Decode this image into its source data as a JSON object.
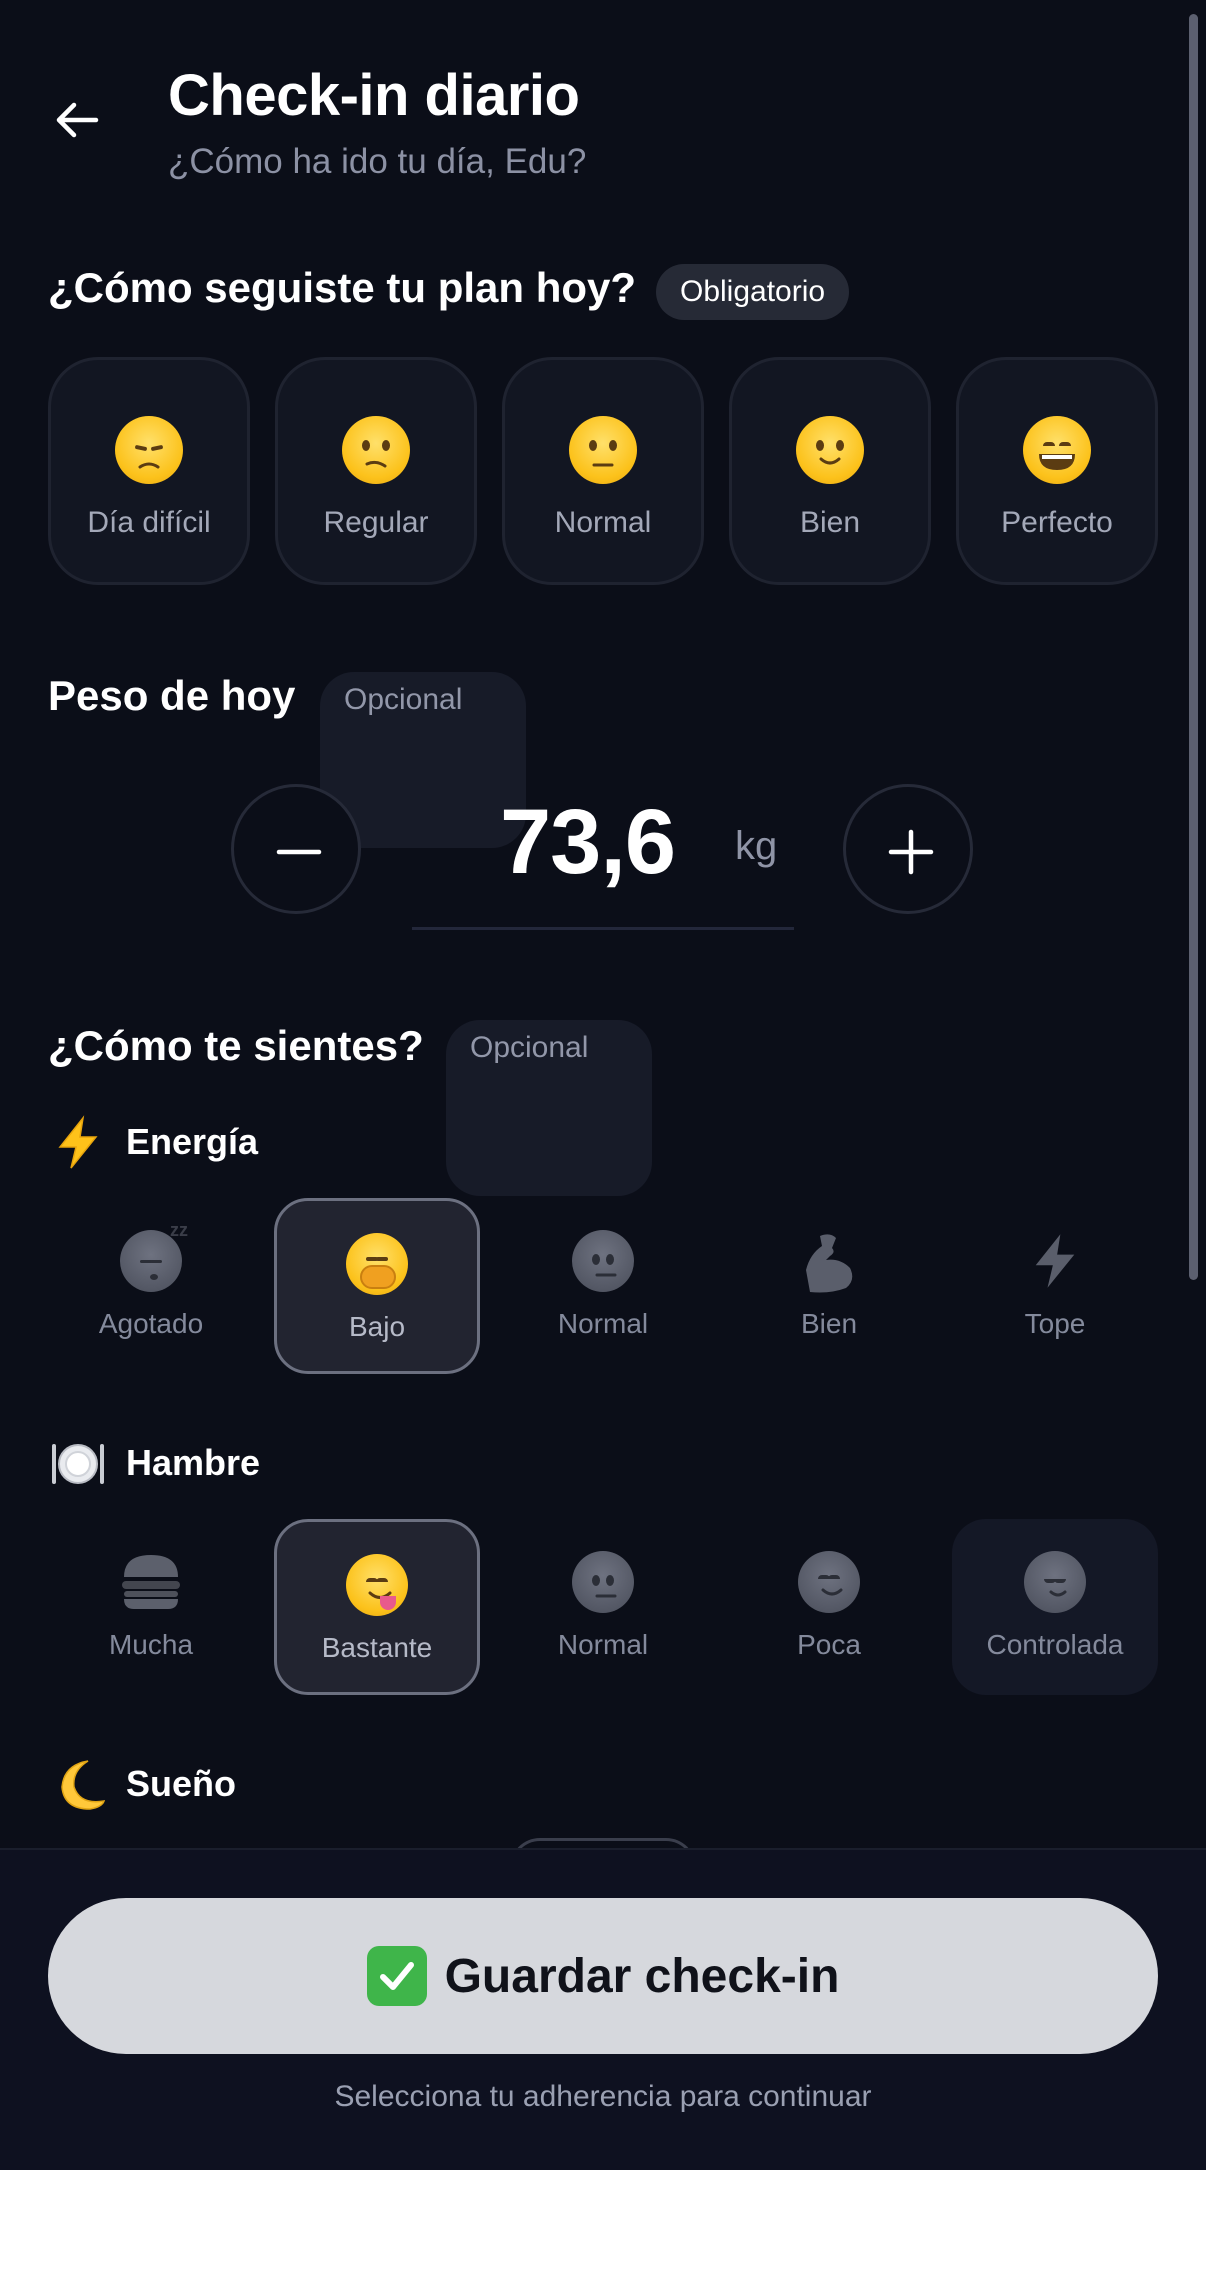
{
  "header": {
    "title": "Check-in diario",
    "subtitle": "¿Cómo ha ido tu día, Edu?",
    "back_icon": "arrow-left-icon"
  },
  "adherence": {
    "title": "¿Cómo seguiste tu plan hoy?",
    "badge": "Obligatorio",
    "options": [
      {
        "label": "Día difícil",
        "icon": "pensive-face-icon"
      },
      {
        "label": "Regular",
        "icon": "confused-face-icon"
      },
      {
        "label": "Normal",
        "icon": "neutral-face-icon"
      },
      {
        "label": "Bien",
        "icon": "slightly-smiling-face-icon"
      },
      {
        "label": "Perfecto",
        "icon": "grinning-face-icon"
      }
    ]
  },
  "weight": {
    "title": "Peso de hoy",
    "badge": "Opcional",
    "value": "73,6",
    "unit": "kg",
    "decrement_icon": "minus-icon",
    "increment_icon": "plus-icon"
  },
  "feelings": {
    "title": "¿Cómo te sientes?",
    "badge": "Opcional",
    "energy": {
      "label": "Energía",
      "icon": "lightning-icon",
      "selected": "Bajo",
      "options": [
        {
          "label": "Agotado",
          "icon": "sleeping-face-icon"
        },
        {
          "label": "Bajo",
          "icon": "yawning-face-icon"
        },
        {
          "label": "Normal",
          "icon": "neutral-face-icon"
        },
        {
          "label": "Bien",
          "icon": "flexed-biceps-icon"
        },
        {
          "label": "Tope",
          "icon": "lightning-icon"
        }
      ]
    },
    "hunger": {
      "label": "Hambre",
      "icon": "plate-cutlery-icon",
      "selected": "Bastante",
      "options": [
        {
          "label": "Mucha",
          "icon": "hamburger-icon"
        },
        {
          "label": "Bastante",
          "icon": "yum-face-icon"
        },
        {
          "label": "Normal",
          "icon": "neutral-face-icon"
        },
        {
          "label": "Poca",
          "icon": "smiling-face-icon"
        },
        {
          "label": "Controlada",
          "icon": "relieved-face-icon"
        }
      ]
    },
    "sleep": {
      "label": "Sueño",
      "icon": "crescent-moon-icon"
    }
  },
  "footer": {
    "save_label": "Guardar check-in",
    "save_icon": "check-mark-button-icon",
    "hint": "Selecciona tu adherencia para continuar"
  },
  "colors": {
    "background": "#0b0e18",
    "card": "#121622",
    "button": "#d6d8dd",
    "muted_text": "#8c91a4",
    "check_green": "#3fb54a"
  }
}
